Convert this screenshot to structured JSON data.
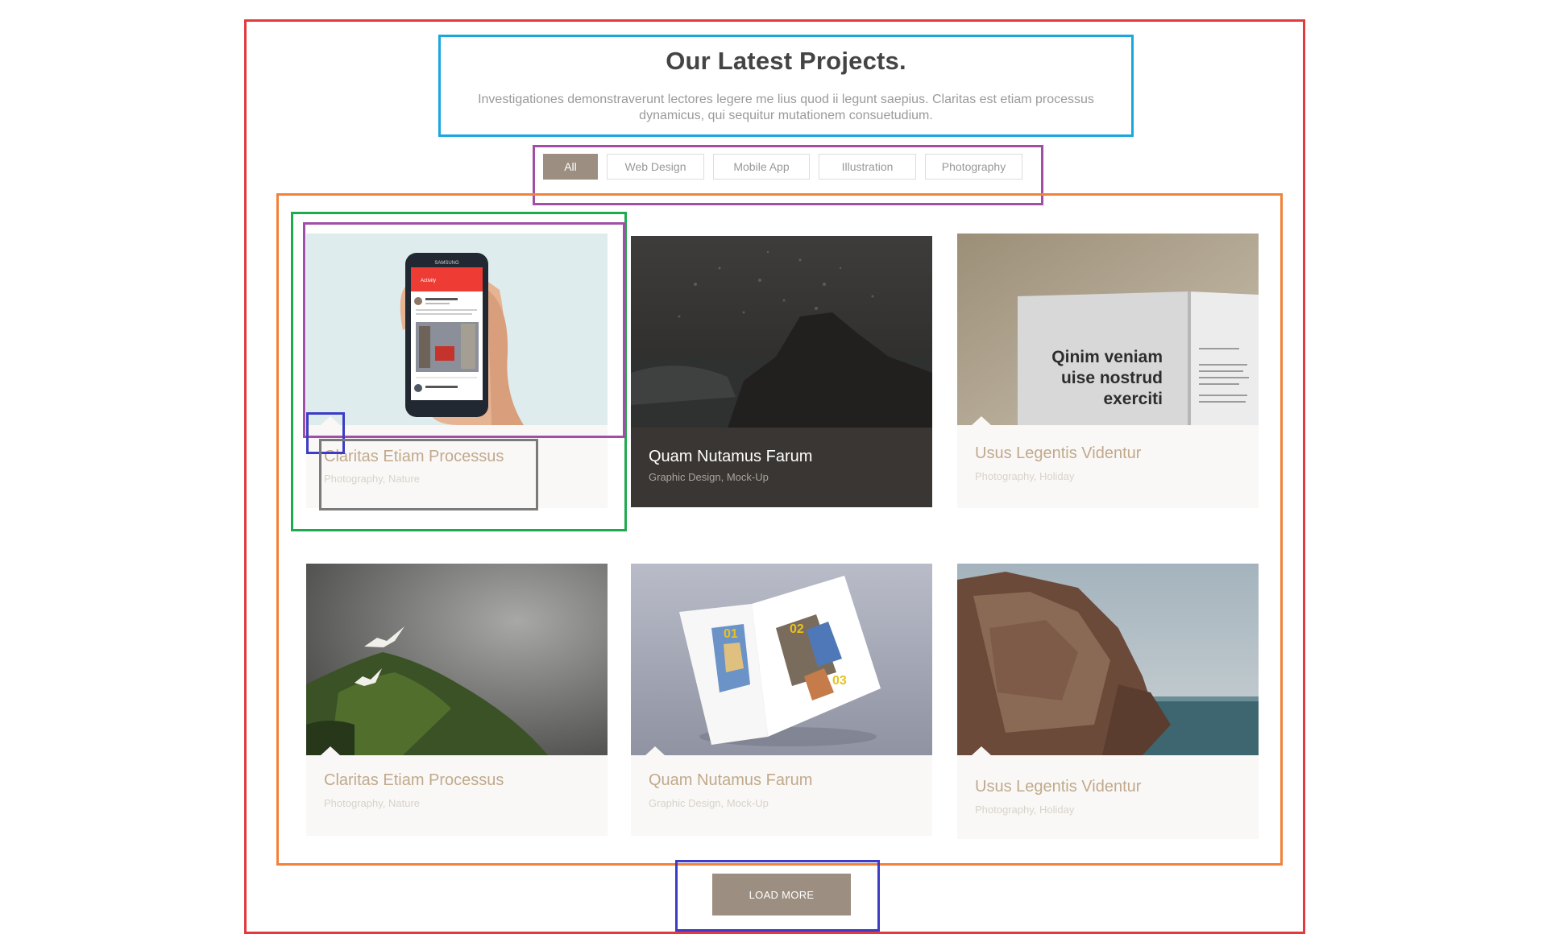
{
  "section": {
    "title": "Our Latest Projects.",
    "subtitle": "Investigationes demonstraverunt lectores legere me lius quod ii legunt saepius. Claritas est etiam processus dynamicus, qui sequitur mutationem consuetudium."
  },
  "filters": [
    {
      "label": "All",
      "active": true
    },
    {
      "label": "Web Design",
      "active": false
    },
    {
      "label": "Mobile App",
      "active": false
    },
    {
      "label": "Illustration",
      "active": false
    },
    {
      "label": "Photography",
      "active": false
    }
  ],
  "projects": [
    {
      "title": "Claritas Etiam Processus",
      "categories": "Photography, Nature",
      "image": "phone-in-hand-photo"
    },
    {
      "title": "Quam Nutamus Farum",
      "categories": "Graphic Design, Mock-Up",
      "image": "ocean-splash-rock-photo",
      "hover": true
    },
    {
      "title": "Usus Legentis Videntur",
      "categories": "Photography, Holiday",
      "image": "open-book-mockup-photo"
    },
    {
      "title": "Claritas Etiam Processus",
      "categories": "Photography, Nature",
      "image": "mossy-hill-birds-photo"
    },
    {
      "title": "Quam Nutamus Farum",
      "categories": "Graphic Design, Mock-Up",
      "image": "magazine-mockup-photo"
    },
    {
      "title": "Usus Legentis Videntur",
      "categories": "Photography, Holiday",
      "image": "rocky-coast-photo"
    }
  ],
  "book_mockup_text": [
    "Qinim veniam",
    "uise nostrud",
    "exerciti"
  ],
  "phone_mockup_text": {
    "brand": "SAMSUNG",
    "app": "Activity"
  },
  "magazine_numbers": [
    "01",
    "02",
    "03"
  ],
  "load_more_label": "LOAD MORE",
  "colors": {
    "accent": "#9c8e80",
    "card_title": "#c0a98c",
    "card_bg": "#faf8f6",
    "heading": "#444444"
  }
}
